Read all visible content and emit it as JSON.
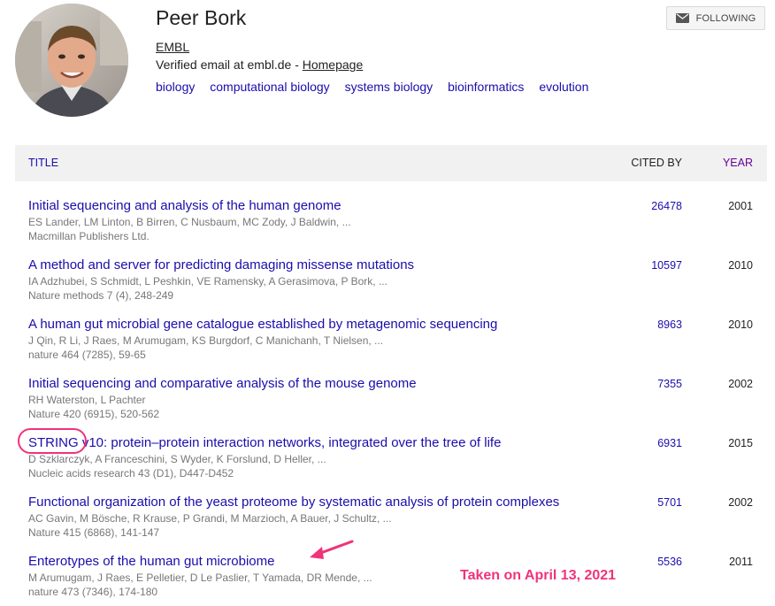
{
  "profile": {
    "name": "Peer Bork",
    "affiliation": "EMBL",
    "verified_text": "Verified email at embl.de - ",
    "homepage_label": "Homepage",
    "interests": [
      "biology",
      "computational biology",
      "systems biology",
      "bioinformatics",
      "evolution"
    ]
  },
  "follow": {
    "label": "FOLLOWING"
  },
  "table": {
    "col_title": "TITLE",
    "col_cited": "CITED BY",
    "col_year": "YEAR"
  },
  "publications": [
    {
      "title": "Initial sequencing and analysis of the human genome",
      "authors": "ES Lander, LM Linton, B Birren, C Nusbaum, MC Zody, J Baldwin, ...",
      "venue": "Macmillan Publishers Ltd.",
      "cited_by": "26478",
      "year": "2001"
    },
    {
      "title": "A method and server for predicting damaging missense mutations",
      "authors": "IA Adzhubei, S Schmidt, L Peshkin, VE Ramensky, A Gerasimova, P Bork, ...",
      "venue": "Nature methods 7 (4), 248-249",
      "cited_by": "10597",
      "year": "2010"
    },
    {
      "title": "A human gut microbial gene catalogue established by metagenomic sequencing",
      "authors": "J Qin, R Li, J Raes, M Arumugam, KS Burgdorf, C Manichanh, T Nielsen, ...",
      "venue": "nature 464 (7285), 59-65",
      "cited_by": "8963",
      "year": "2010"
    },
    {
      "title": "Initial sequencing and comparative analysis of the mouse genome",
      "authors": "RH Waterston, L Pachter",
      "venue": "Nature 420 (6915), 520-562",
      "cited_by": "7355",
      "year": "2002"
    },
    {
      "title": "STRING v10: protein–protein interaction networks, integrated over the tree of life",
      "authors": "D Szklarczyk, A Franceschini, S Wyder, K Forslund, D Heller, ...",
      "venue": "Nucleic acids research 43 (D1), D447-D452",
      "cited_by": "6931",
      "year": "2015"
    },
    {
      "title": "Functional organization of the yeast proteome by systematic analysis of protein complexes",
      "authors": "AC Gavin, M Bösche, R Krause, P Grandi, M Marzioch, A Bauer, J Schultz, ...",
      "venue": "Nature 415 (6868), 141-147",
      "cited_by": "5701",
      "year": "2002"
    },
    {
      "title": "Enterotypes of the human gut microbiome",
      "authors": "M Arumugam, J Raes, E Pelletier, D Le Paslier, T Yamada, DR Mende, ...",
      "venue": "nature 473 (7346), 174-180",
      "cited_by": "5536",
      "year": "2011"
    }
  ],
  "annotation": {
    "text": "Taken on April 13, 2021",
    "color": "#f0337a"
  },
  "colors": {
    "link": "#1a0dab",
    "year_header": "#660099",
    "meta_text": "#777777",
    "header_bg": "#f1f1f1"
  },
  "icons": {
    "follow": "envelope-icon",
    "avatar": "profile-photo"
  }
}
